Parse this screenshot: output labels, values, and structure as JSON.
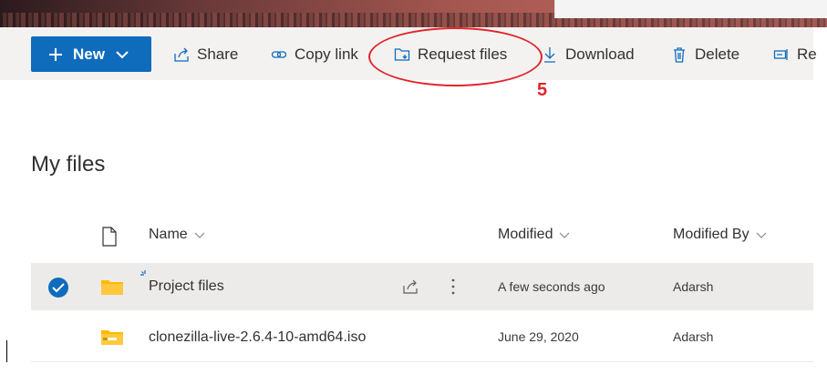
{
  "toolbar": {
    "new_label": "New",
    "share_label": "Share",
    "copy_link_label": "Copy link",
    "request_files_label": "Request files",
    "download_label": "Download",
    "delete_label": "Delete",
    "rename_label": "Re"
  },
  "annotation": {
    "number": "5",
    "color": "#e0252b"
  },
  "page": {
    "title": "My files"
  },
  "columns": {
    "name": "Name",
    "modified": "Modified",
    "modified_by": "Modified By"
  },
  "files": [
    {
      "name": "Project files",
      "modified": "A few seconds ago",
      "modified_by": "Adarsh",
      "icon": "folder-icon",
      "selected": true
    },
    {
      "name": "clonezilla-live-2.6.4-10-amd64.iso",
      "modified": "June 29, 2020",
      "modified_by": "Adarsh",
      "icon": "zip-folder-icon",
      "selected": false
    }
  ],
  "colors": {
    "accent": "#0f6cbd",
    "folder": "#ffb900",
    "command_bar": "#f3f2f1"
  }
}
